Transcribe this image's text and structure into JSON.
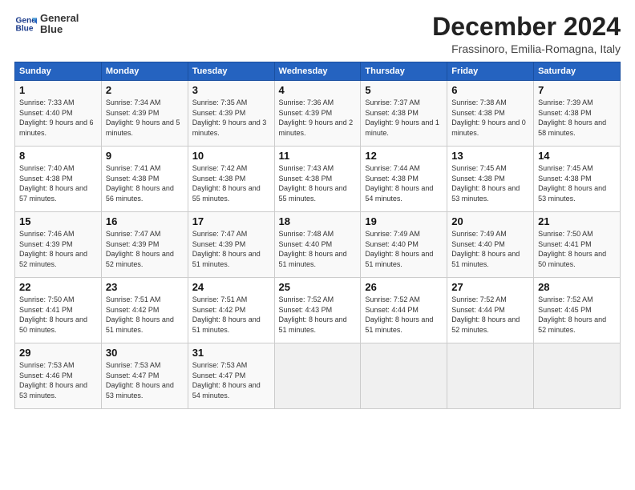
{
  "logo": {
    "line1": "General",
    "line2": "Blue"
  },
  "title": "December 2024",
  "subtitle": "Frassinoro, Emilia-Romagna, Italy",
  "days_of_week": [
    "Sunday",
    "Monday",
    "Tuesday",
    "Wednesday",
    "Thursday",
    "Friday",
    "Saturday"
  ],
  "weeks": [
    [
      {
        "day": "1",
        "sunrise": "7:33 AM",
        "sunset": "4:40 PM",
        "daylight": "9 hours and 6 minutes."
      },
      {
        "day": "2",
        "sunrise": "7:34 AM",
        "sunset": "4:39 PM",
        "daylight": "9 hours and 5 minutes."
      },
      {
        "day": "3",
        "sunrise": "7:35 AM",
        "sunset": "4:39 PM",
        "daylight": "9 hours and 3 minutes."
      },
      {
        "day": "4",
        "sunrise": "7:36 AM",
        "sunset": "4:39 PM",
        "daylight": "9 hours and 2 minutes."
      },
      {
        "day": "5",
        "sunrise": "7:37 AM",
        "sunset": "4:38 PM",
        "daylight": "9 hours and 1 minute."
      },
      {
        "day": "6",
        "sunrise": "7:38 AM",
        "sunset": "4:38 PM",
        "daylight": "9 hours and 0 minutes."
      },
      {
        "day": "7",
        "sunrise": "7:39 AM",
        "sunset": "4:38 PM",
        "daylight": "8 hours and 58 minutes."
      }
    ],
    [
      {
        "day": "8",
        "sunrise": "7:40 AM",
        "sunset": "4:38 PM",
        "daylight": "8 hours and 57 minutes."
      },
      {
        "day": "9",
        "sunrise": "7:41 AM",
        "sunset": "4:38 PM",
        "daylight": "8 hours and 56 minutes."
      },
      {
        "day": "10",
        "sunrise": "7:42 AM",
        "sunset": "4:38 PM",
        "daylight": "8 hours and 55 minutes."
      },
      {
        "day": "11",
        "sunrise": "7:43 AM",
        "sunset": "4:38 PM",
        "daylight": "8 hours and 55 minutes."
      },
      {
        "day": "12",
        "sunrise": "7:44 AM",
        "sunset": "4:38 PM",
        "daylight": "8 hours and 54 minutes."
      },
      {
        "day": "13",
        "sunrise": "7:45 AM",
        "sunset": "4:38 PM",
        "daylight": "8 hours and 53 minutes."
      },
      {
        "day": "14",
        "sunrise": "7:45 AM",
        "sunset": "4:38 PM",
        "daylight": "8 hours and 53 minutes."
      }
    ],
    [
      {
        "day": "15",
        "sunrise": "7:46 AM",
        "sunset": "4:39 PM",
        "daylight": "8 hours and 52 minutes."
      },
      {
        "day": "16",
        "sunrise": "7:47 AM",
        "sunset": "4:39 PM",
        "daylight": "8 hours and 52 minutes."
      },
      {
        "day": "17",
        "sunrise": "7:47 AM",
        "sunset": "4:39 PM",
        "daylight": "8 hours and 51 minutes."
      },
      {
        "day": "18",
        "sunrise": "7:48 AM",
        "sunset": "4:40 PM",
        "daylight": "8 hours and 51 minutes."
      },
      {
        "day": "19",
        "sunrise": "7:49 AM",
        "sunset": "4:40 PM",
        "daylight": "8 hours and 51 minutes."
      },
      {
        "day": "20",
        "sunrise": "7:49 AM",
        "sunset": "4:40 PM",
        "daylight": "8 hours and 51 minutes."
      },
      {
        "day": "21",
        "sunrise": "7:50 AM",
        "sunset": "4:41 PM",
        "daylight": "8 hours and 50 minutes."
      }
    ],
    [
      {
        "day": "22",
        "sunrise": "7:50 AM",
        "sunset": "4:41 PM",
        "daylight": "8 hours and 50 minutes."
      },
      {
        "day": "23",
        "sunrise": "7:51 AM",
        "sunset": "4:42 PM",
        "daylight": "8 hours and 51 minutes."
      },
      {
        "day": "24",
        "sunrise": "7:51 AM",
        "sunset": "4:42 PM",
        "daylight": "8 hours and 51 minutes."
      },
      {
        "day": "25",
        "sunrise": "7:52 AM",
        "sunset": "4:43 PM",
        "daylight": "8 hours and 51 minutes."
      },
      {
        "day": "26",
        "sunrise": "7:52 AM",
        "sunset": "4:44 PM",
        "daylight": "8 hours and 51 minutes."
      },
      {
        "day": "27",
        "sunrise": "7:52 AM",
        "sunset": "4:44 PM",
        "daylight": "8 hours and 52 minutes."
      },
      {
        "day": "28",
        "sunrise": "7:52 AM",
        "sunset": "4:45 PM",
        "daylight": "8 hours and 52 minutes."
      }
    ],
    [
      {
        "day": "29",
        "sunrise": "7:53 AM",
        "sunset": "4:46 PM",
        "daylight": "8 hours and 53 minutes."
      },
      {
        "day": "30",
        "sunrise": "7:53 AM",
        "sunset": "4:47 PM",
        "daylight": "8 hours and 53 minutes."
      },
      {
        "day": "31",
        "sunrise": "7:53 AM",
        "sunset": "4:47 PM",
        "daylight": "8 hours and 54 minutes."
      },
      null,
      null,
      null,
      null
    ]
  ],
  "accent_color": "#2563c0"
}
